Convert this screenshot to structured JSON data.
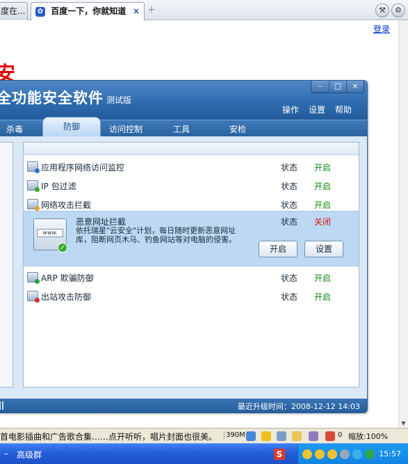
{
  "browser": {
    "tabs": [
      {
        "label": "度在..."
      },
      {
        "label": "百度一下，你就知道",
        "close": "×"
      }
    ],
    "new_tab": "+",
    "tools_icon": "wrench-icon",
    "menu_icon": "gear-icon"
  },
  "page": {
    "login_link": "登录",
    "big_red_text": "安"
  },
  "app": {
    "title": "全功能安全软件",
    "title_suffix": "测试版",
    "window_buttons": [
      "–",
      "□",
      "×"
    ],
    "menu": [
      "操作",
      "设置",
      "帮助"
    ],
    "tabs": [
      "杀毒",
      "防御",
      "访问控制",
      "工具",
      "安检"
    ],
    "active_tab_index": 1,
    "rows_top": [
      {
        "name": "应用程序网络访问监控",
        "status_label": "状态",
        "status": "开启",
        "icon": "app-monitor-icon"
      },
      {
        "name": "IP 包过滤",
        "status_label": "状态",
        "status": "开启",
        "icon": "ip-filter-icon"
      },
      {
        "name": "网络攻击拦截",
        "status_label": "状态",
        "status": "开启",
        "icon": "attack-block-icon"
      }
    ],
    "selected_row": {
      "name": "恶意网址拦截",
      "icon_text": "www.",
      "description": "依托瑞星\"云安全\"计划，每日随时更新恶意网址库，阻断网页木马、钓鱼网站等对电脑的侵害。",
      "status_label": "状态",
      "status": "关闭",
      "enable_button": "开启",
      "settings_button": "设置"
    },
    "rows_bottom": [
      {
        "name": "ARP 欺骗防御",
        "status_label": "状态",
        "status": "开启",
        "icon": "arp-defense-icon"
      },
      {
        "name": "出站攻击防御",
        "status_label": "状态",
        "status": "开启",
        "icon": "outbound-defense-icon"
      }
    ],
    "footer": {
      "last_update": "最近升级时间：2008-12-12 14:03"
    },
    "colors": {
      "status_on": "#138a12",
      "status_off": "#d8150d",
      "header": "#2d6aad"
    }
  },
  "statusbar": {
    "text": "首电影插曲和广告歌合集……点开听听，唱片封面也很美。",
    "memory": "390M",
    "count": "0",
    "zoom": "缩放:100%"
  },
  "taskbar": {
    "left_item": "–",
    "item": "高级群",
    "clock": "15:57"
  }
}
